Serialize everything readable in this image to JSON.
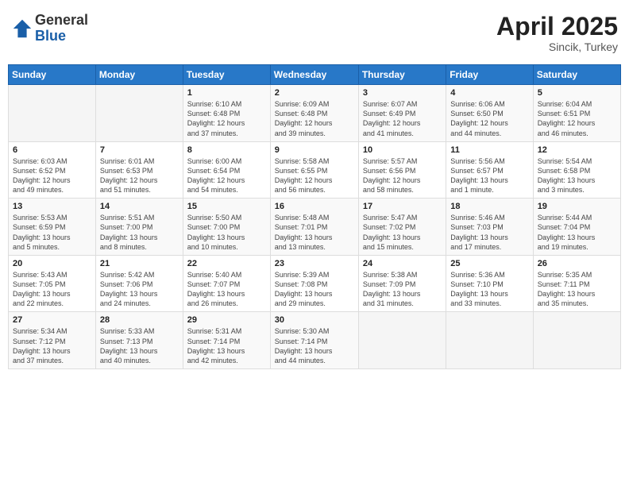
{
  "header": {
    "logo_general": "General",
    "logo_blue": "Blue",
    "month_title": "April 2025",
    "location": "Sincik, Turkey"
  },
  "weekdays": [
    "Sunday",
    "Monday",
    "Tuesday",
    "Wednesday",
    "Thursday",
    "Friday",
    "Saturday"
  ],
  "weeks": [
    [
      {
        "day": "",
        "info": ""
      },
      {
        "day": "",
        "info": ""
      },
      {
        "day": "1",
        "info": "Sunrise: 6:10 AM\nSunset: 6:48 PM\nDaylight: 12 hours\nand 37 minutes."
      },
      {
        "day": "2",
        "info": "Sunrise: 6:09 AM\nSunset: 6:48 PM\nDaylight: 12 hours\nand 39 minutes."
      },
      {
        "day": "3",
        "info": "Sunrise: 6:07 AM\nSunset: 6:49 PM\nDaylight: 12 hours\nand 41 minutes."
      },
      {
        "day": "4",
        "info": "Sunrise: 6:06 AM\nSunset: 6:50 PM\nDaylight: 12 hours\nand 44 minutes."
      },
      {
        "day": "5",
        "info": "Sunrise: 6:04 AM\nSunset: 6:51 PM\nDaylight: 12 hours\nand 46 minutes."
      }
    ],
    [
      {
        "day": "6",
        "info": "Sunrise: 6:03 AM\nSunset: 6:52 PM\nDaylight: 12 hours\nand 49 minutes."
      },
      {
        "day": "7",
        "info": "Sunrise: 6:01 AM\nSunset: 6:53 PM\nDaylight: 12 hours\nand 51 minutes."
      },
      {
        "day": "8",
        "info": "Sunrise: 6:00 AM\nSunset: 6:54 PM\nDaylight: 12 hours\nand 54 minutes."
      },
      {
        "day": "9",
        "info": "Sunrise: 5:58 AM\nSunset: 6:55 PM\nDaylight: 12 hours\nand 56 minutes."
      },
      {
        "day": "10",
        "info": "Sunrise: 5:57 AM\nSunset: 6:56 PM\nDaylight: 12 hours\nand 58 minutes."
      },
      {
        "day": "11",
        "info": "Sunrise: 5:56 AM\nSunset: 6:57 PM\nDaylight: 13 hours\nand 1 minute."
      },
      {
        "day": "12",
        "info": "Sunrise: 5:54 AM\nSunset: 6:58 PM\nDaylight: 13 hours\nand 3 minutes."
      }
    ],
    [
      {
        "day": "13",
        "info": "Sunrise: 5:53 AM\nSunset: 6:59 PM\nDaylight: 13 hours\nand 5 minutes."
      },
      {
        "day": "14",
        "info": "Sunrise: 5:51 AM\nSunset: 7:00 PM\nDaylight: 13 hours\nand 8 minutes."
      },
      {
        "day": "15",
        "info": "Sunrise: 5:50 AM\nSunset: 7:00 PM\nDaylight: 13 hours\nand 10 minutes."
      },
      {
        "day": "16",
        "info": "Sunrise: 5:48 AM\nSunset: 7:01 PM\nDaylight: 13 hours\nand 13 minutes."
      },
      {
        "day": "17",
        "info": "Sunrise: 5:47 AM\nSunset: 7:02 PM\nDaylight: 13 hours\nand 15 minutes."
      },
      {
        "day": "18",
        "info": "Sunrise: 5:46 AM\nSunset: 7:03 PM\nDaylight: 13 hours\nand 17 minutes."
      },
      {
        "day": "19",
        "info": "Sunrise: 5:44 AM\nSunset: 7:04 PM\nDaylight: 13 hours\nand 19 minutes."
      }
    ],
    [
      {
        "day": "20",
        "info": "Sunrise: 5:43 AM\nSunset: 7:05 PM\nDaylight: 13 hours\nand 22 minutes."
      },
      {
        "day": "21",
        "info": "Sunrise: 5:42 AM\nSunset: 7:06 PM\nDaylight: 13 hours\nand 24 minutes."
      },
      {
        "day": "22",
        "info": "Sunrise: 5:40 AM\nSunset: 7:07 PM\nDaylight: 13 hours\nand 26 minutes."
      },
      {
        "day": "23",
        "info": "Sunrise: 5:39 AM\nSunset: 7:08 PM\nDaylight: 13 hours\nand 29 minutes."
      },
      {
        "day": "24",
        "info": "Sunrise: 5:38 AM\nSunset: 7:09 PM\nDaylight: 13 hours\nand 31 minutes."
      },
      {
        "day": "25",
        "info": "Sunrise: 5:36 AM\nSunset: 7:10 PM\nDaylight: 13 hours\nand 33 minutes."
      },
      {
        "day": "26",
        "info": "Sunrise: 5:35 AM\nSunset: 7:11 PM\nDaylight: 13 hours\nand 35 minutes."
      }
    ],
    [
      {
        "day": "27",
        "info": "Sunrise: 5:34 AM\nSunset: 7:12 PM\nDaylight: 13 hours\nand 37 minutes."
      },
      {
        "day": "28",
        "info": "Sunrise: 5:33 AM\nSunset: 7:13 PM\nDaylight: 13 hours\nand 40 minutes."
      },
      {
        "day": "29",
        "info": "Sunrise: 5:31 AM\nSunset: 7:14 PM\nDaylight: 13 hours\nand 42 minutes."
      },
      {
        "day": "30",
        "info": "Sunrise: 5:30 AM\nSunset: 7:14 PM\nDaylight: 13 hours\nand 44 minutes."
      },
      {
        "day": "",
        "info": ""
      },
      {
        "day": "",
        "info": ""
      },
      {
        "day": "",
        "info": ""
      }
    ]
  ]
}
